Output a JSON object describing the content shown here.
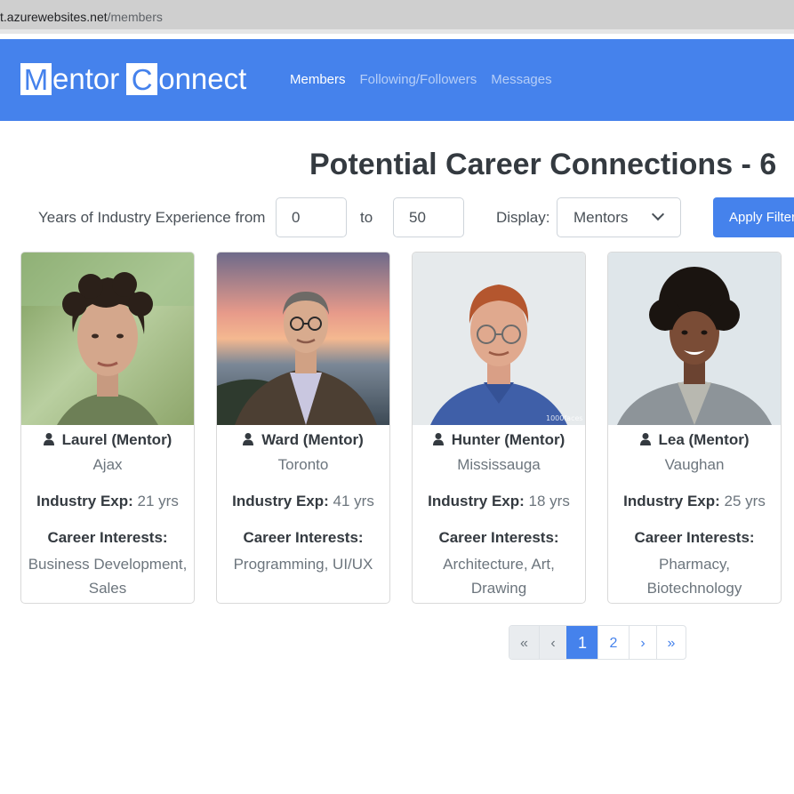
{
  "browser": {
    "url_host": "t.azurewebsites.net",
    "url_path": "/members"
  },
  "navbar": {
    "logo_first_letter": "M",
    "logo_first_rest": "entor",
    "logo_second_letter": "C",
    "logo_second_rest": "onnect",
    "links": [
      {
        "label": "Members",
        "active": true
      },
      {
        "label": "Following/Followers",
        "active": false
      },
      {
        "label": "Messages",
        "active": false
      }
    ]
  },
  "page": {
    "title": "Potential Career Connections - 6"
  },
  "filters": {
    "experience_label": "Years of Industry Experience from",
    "from_value": "0",
    "to_label": "to",
    "to_value": "50",
    "display_label": "Display:",
    "display_value": "Mentors",
    "apply_label": "Apply Filters"
  },
  "cards": [
    {
      "name": "Laurel (Mentor)",
      "city": "Ajax",
      "exp_label": "Industry Exp:",
      "exp_value": "21 yrs",
      "interests_label": "Career Interests:",
      "interests": "Business Development, Sales"
    },
    {
      "name": "Ward (Mentor)",
      "city": "Toronto",
      "exp_label": "Industry Exp:",
      "exp_value": "41 yrs",
      "interests_label": "Career Interests:",
      "interests": "Programming, UI/UX"
    },
    {
      "name": "Hunter (Mentor)",
      "city": "Mississauga",
      "exp_label": "Industry Exp:",
      "exp_value": "18 yrs",
      "interests_label": "Career Interests:",
      "interests": "Architecture, Art, Drawing"
    },
    {
      "name": "Lea (Mentor)",
      "city": "Vaughan",
      "exp_label": "Industry Exp:",
      "exp_value": "25 yrs",
      "interests_label": "Career Interests:",
      "interests": "Pharmacy, Biotechnology"
    }
  ],
  "photo_watermark": "1000faces",
  "pagination": {
    "first": "«",
    "prev": "‹",
    "pages": [
      "1",
      "2"
    ],
    "current_page": "1",
    "next": "›",
    "last": "»"
  },
  "colors": {
    "brand": "#4582ec",
    "heading": "#343a40",
    "muted": "#6c757d"
  }
}
